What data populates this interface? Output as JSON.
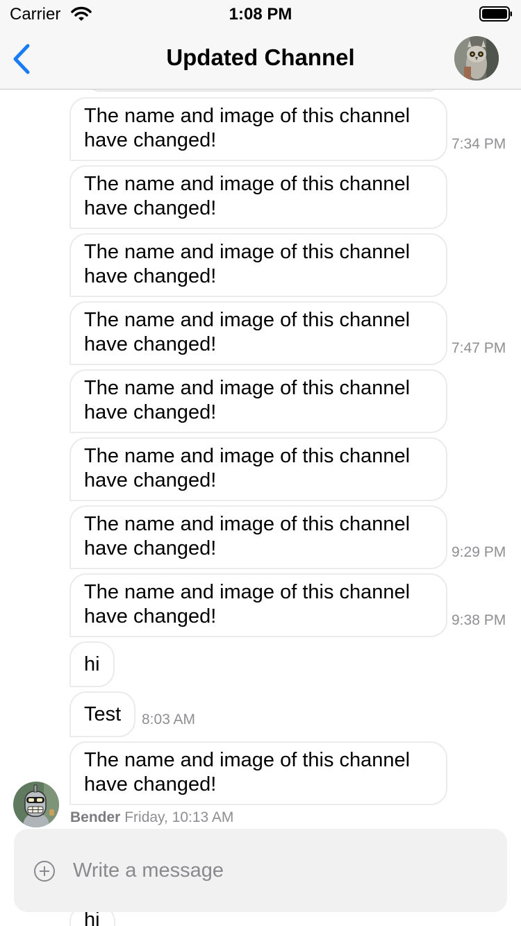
{
  "status_bar": {
    "carrier": "Carrier",
    "time": "1:08 PM"
  },
  "nav": {
    "title": "Updated Channel"
  },
  "messages": [
    {
      "text": "The name and image of this channel have changed!",
      "time": "7:34 PM"
    },
    {
      "text": "The name and image of this channel have changed!",
      "time": ""
    },
    {
      "text": "The name and image of this channel have changed!",
      "time": ""
    },
    {
      "text": "The name and image of this channel have changed!",
      "time": "7:47 PM"
    },
    {
      "text": "The name and image of this channel have changed!",
      "time": ""
    },
    {
      "text": "The name and image of this channel have changed!",
      "time": ""
    },
    {
      "text": "The name and image of this channel have changed!",
      "time": "9:29 PM"
    },
    {
      "text": "The name and image of this channel have changed!",
      "time": "9:38 PM"
    },
    {
      "text": "hi",
      "time": ""
    },
    {
      "text": "Test",
      "time": "8:03 AM"
    },
    {
      "text": "The name and image of this channel have changed!",
      "time": ""
    }
  ],
  "last_group": {
    "author": "Bender",
    "date": "Friday, 10:13 AM"
  },
  "composer": {
    "placeholder": "Write a message"
  },
  "bottom_peek": {
    "text": "hi"
  },
  "colors": {
    "accent": "#1a7cf5",
    "bubble_border": "#ebebeb",
    "muted": "#8e8e93"
  },
  "icons": {
    "back": "chevron-left-icon",
    "attach": "plus-circle-icon",
    "wifi": "wifi-icon",
    "battery": "battery-icon"
  }
}
